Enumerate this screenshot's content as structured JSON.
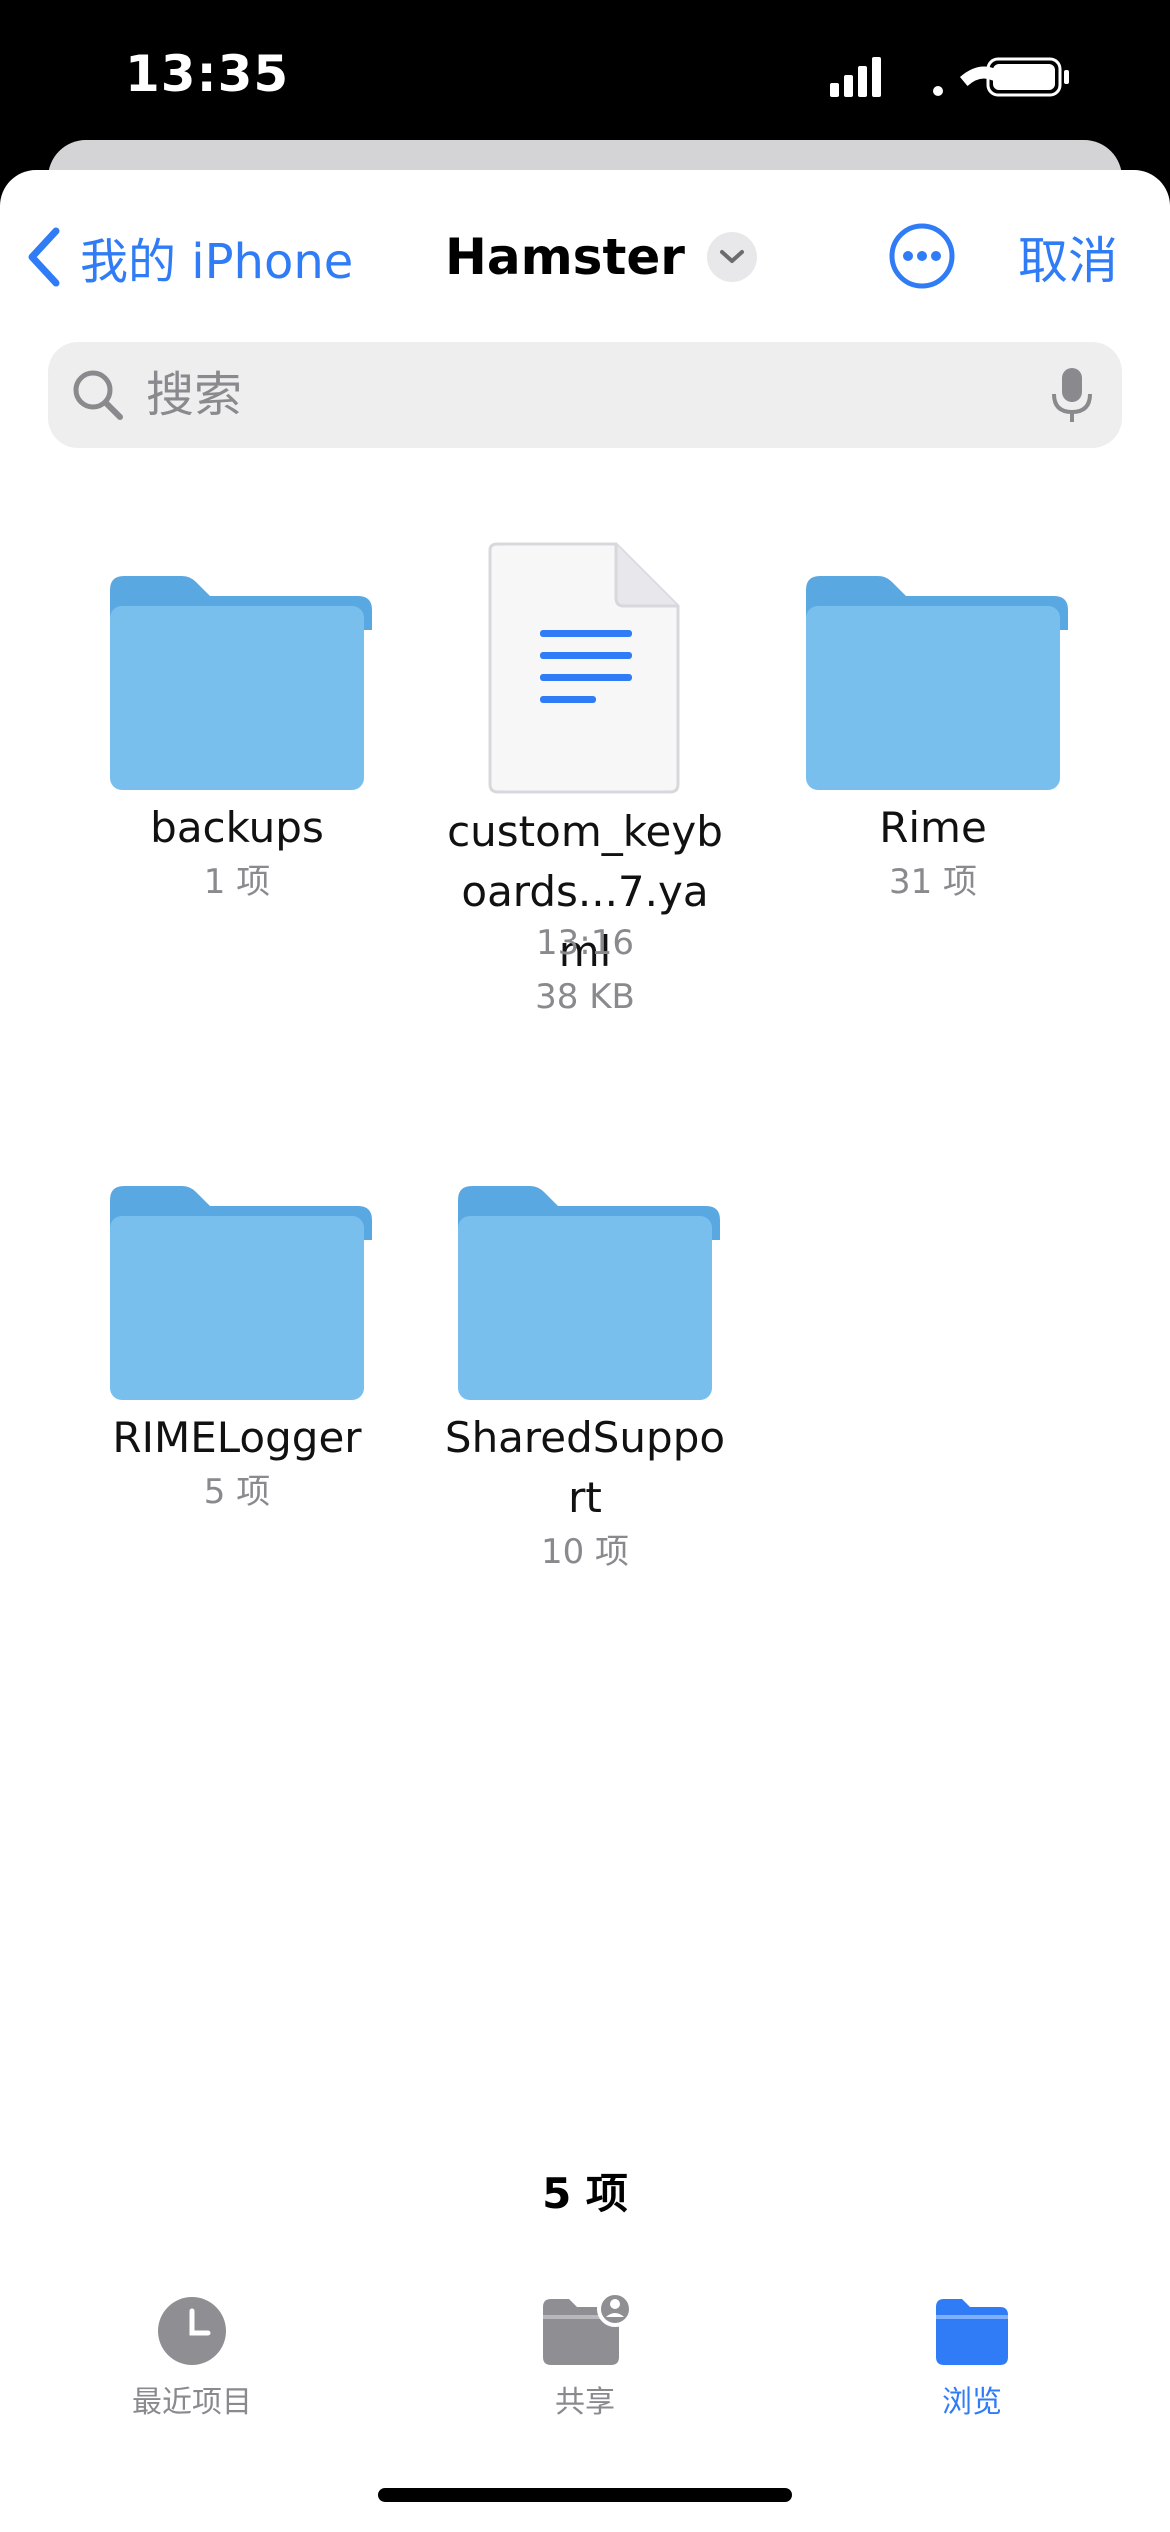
{
  "status_bar": {
    "time": "13:35"
  },
  "nav": {
    "back_label": "我的 iPhone",
    "title": "Hamster",
    "cancel_label": "取消"
  },
  "search": {
    "placeholder": "搜索"
  },
  "items": [
    {
      "name": "backups",
      "meta": "1 项",
      "kind": "folder"
    },
    {
      "name": "custom_keyboards...7.yaml",
      "time": "13:16",
      "size": "38 KB",
      "kind": "document"
    },
    {
      "name": "Rime",
      "meta": "31 项",
      "kind": "folder"
    },
    {
      "name": "RIMELogger",
      "meta": "5 项",
      "kind": "folder"
    },
    {
      "name": "SharedSupport",
      "meta": "10 项",
      "kind": "folder"
    }
  ],
  "footer": {
    "count": "5 项"
  },
  "tabs": [
    {
      "label": "最近项目",
      "icon": "clock-icon",
      "active": false
    },
    {
      "label": "共享",
      "icon": "shared-folder-icon",
      "active": false
    },
    {
      "label": "浏览",
      "icon": "folder-icon",
      "active": true
    }
  ],
  "colors": {
    "accent": "#2f7cf6",
    "folder": "#74bdee",
    "secondary_text": "#8a8a8e"
  }
}
